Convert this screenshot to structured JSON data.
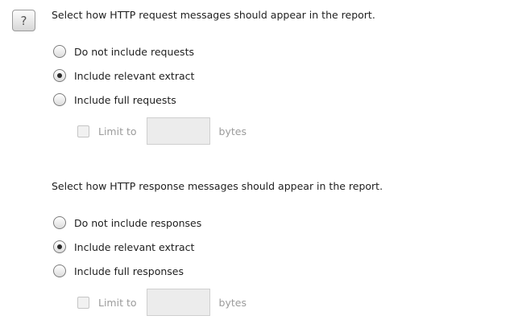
{
  "help": {
    "glyph": "?",
    "icon": "help-icon"
  },
  "request": {
    "heading": "Select how HTTP request messages should appear in the report.",
    "options": [
      {
        "label": "Do not include requests",
        "selected": false
      },
      {
        "label": "Include relevant extract",
        "selected": true
      },
      {
        "label": "Include full requests",
        "selected": false
      }
    ],
    "limit": {
      "label": "Limit to",
      "value": "",
      "unit": "bytes",
      "enabled": false,
      "checked": false
    }
  },
  "response": {
    "heading": "Select how HTTP response messages should appear in the report.",
    "options": [
      {
        "label": "Do not include responses",
        "selected": false
      },
      {
        "label": "Include relevant extract",
        "selected": true
      },
      {
        "label": "Include full responses",
        "selected": false
      }
    ],
    "limit": {
      "label": "Limit to",
      "value": "",
      "unit": "bytes",
      "enabled": false,
      "checked": false
    }
  }
}
